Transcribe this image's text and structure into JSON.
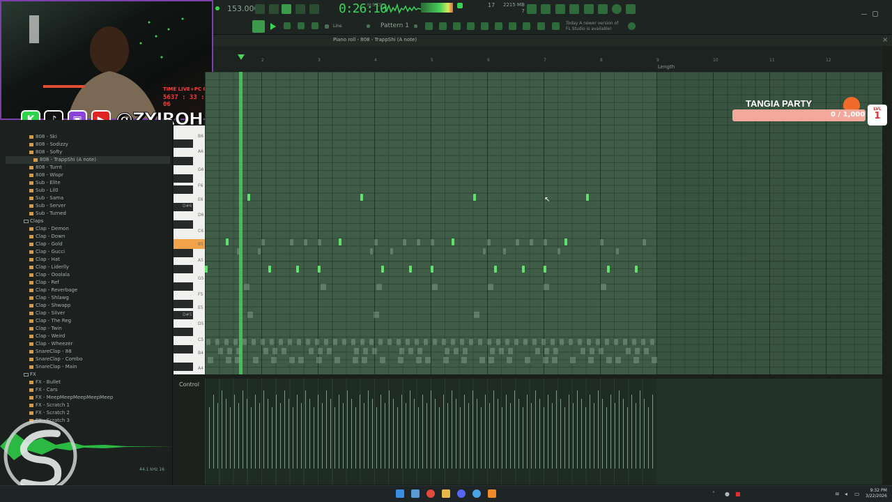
{
  "toolbar": {
    "tempo": "153.000",
    "song_time": "0:26:10",
    "time_unit": "M:S:CS",
    "cpu_value": "17",
    "memory": "2215 MB",
    "memory_sub": "7",
    "pattern": "Pattern 1",
    "snap": "Line",
    "news_line1": "Today  A newer version of",
    "news_line2": "FL Studio is available!"
  },
  "piano_roll": {
    "title": "Piano roll - 808 - TrappShi (A note)",
    "length_label": "Length",
    "bar_numbers": [
      "2",
      "3",
      "4",
      "5",
      "6",
      "7",
      "8",
      "9",
      "10",
      "11",
      "12"
    ],
    "key_labels": [
      "B6",
      "A6",
      "G6",
      "F6",
      "E6",
      "D#6",
      "D6",
      "C6",
      "B5",
      "A5",
      "G5",
      "F5",
      "E5",
      "D#5",
      "D5",
      "C5",
      "B4",
      "A4"
    ],
    "highlighted_key": "B5",
    "control_label": "Control"
  },
  "browser": {
    "items_808": [
      "808 - Ski",
      "808 - Sodizzy",
      "808 - Softy",
      "808 - TrappShi (A note)",
      "808 - Turnt",
      "808 - Wispr",
      "Sub - Elite",
      "Sub - Lil0",
      "Sub - Sama",
      "Sub - Server",
      "Sub - Turned"
    ],
    "selected_item": "808 - TrappShi (A note)",
    "folder_claps": "Claps",
    "items_claps": [
      "Clap - Demon",
      "Clap - Down",
      "Clap - Gold",
      "Clap - Gucci",
      "Clap - Hat",
      "Clap - Liderlly",
      "Clap - Ooolala",
      "Clap - Ref",
      "Clap - Reverbage",
      "Clap - Shlawg",
      "Clap - Shwapp",
      "Clap - Silver",
      "Clap - The Reg",
      "Clap - Twin",
      "Clap - Weird",
      "Clap - Wheezer",
      "SnareClap - 88",
      "SnareClap - Combo",
      "SnareClap - Main"
    ],
    "folder_fx": "FX",
    "items_fx": [
      "FX - Bullet",
      "FX - Cars",
      "FX - MeepMeepMeepMeepMeep",
      "FX - Scratch 1",
      "FX - Scratch 2",
      "FX - Scratch 3"
    ],
    "sample_rate": "44.1 kHz 16"
  },
  "stream": {
    "timer_label": "TIME LIVE+PC ON",
    "timer_value": "5637 : 33 : 06",
    "handle": "@ZYIROH",
    "tangia_title": "TANGIA PARTY",
    "tangia_progress": "0 / 1,000",
    "tangia_progress_value": 0,
    "tangia_level_label": "LVL",
    "tangia_level": "1"
  },
  "taskbar": {
    "time": "9:32 PM",
    "date": "3/22/2026"
  },
  "colors": {
    "accent": "#39d353",
    "note": "#5fe06f",
    "highlight_key": "#f2a24a",
    "webcam_border": "#7b3fae"
  }
}
